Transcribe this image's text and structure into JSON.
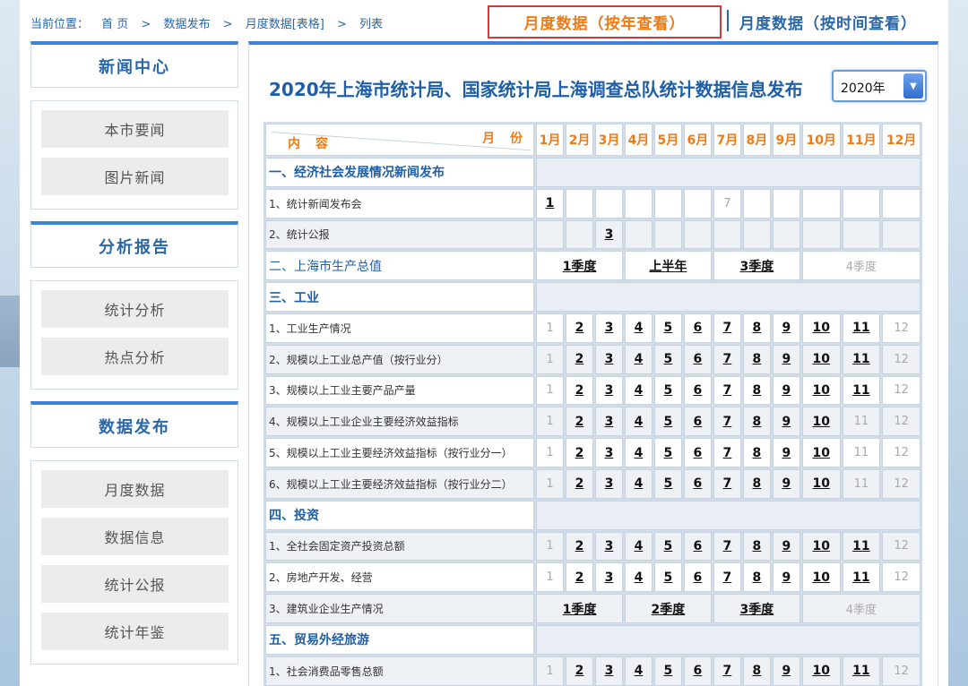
{
  "breadcrumb": {
    "prefix": "当前位置：",
    "items": [
      "首 页",
      "数据发布",
      "月度数据[表格]",
      "列表"
    ],
    "sep": ">"
  },
  "view_tabs": {
    "by_year": "月度数据（按年查看）",
    "by_time": "月度数据（按时间查看）"
  },
  "sidebar": {
    "sections": [
      {
        "title": "新闻中心",
        "items": [
          "本市要闻",
          "图片新闻"
        ]
      },
      {
        "title": "分析报告",
        "items": [
          "统计分析",
          "热点分析"
        ]
      },
      {
        "title": "数据发布",
        "items": [
          "月度数据",
          "数据信息",
          "统计公报",
          "统计年鉴"
        ]
      }
    ]
  },
  "main": {
    "title": "2020年上海市统计局、国家统计局上海调查总队统计数据信息发布",
    "year_select": "2020年",
    "header": {
      "content_label": "内 容",
      "month_label": "月 份",
      "months": [
        "1月",
        "2月",
        "3月",
        "4月",
        "5月",
        "6月",
        "7月",
        "8月",
        "9月",
        "10月",
        "11月",
        "12月"
      ]
    },
    "rows": [
      {
        "type": "section",
        "label": "一、经济社会发展情况新闻发布"
      },
      {
        "type": "monthly",
        "label": "1、统计新闻发布会",
        "cells": [
          {
            "t": "1",
            "on": true
          },
          {
            "t": ""
          },
          {
            "t": ""
          },
          {
            "t": ""
          },
          {
            "t": ""
          },
          {
            "t": ""
          },
          {
            "t": "7",
            "on": false
          },
          {
            "t": ""
          },
          {
            "t": ""
          },
          {
            "t": ""
          },
          {
            "t": ""
          },
          {
            "t": ""
          }
        ]
      },
      {
        "type": "monthly",
        "label": "2、统计公报",
        "alt": true,
        "cells": [
          {
            "t": ""
          },
          {
            "t": ""
          },
          {
            "t": "3",
            "on": true
          },
          {
            "t": ""
          },
          {
            "t": ""
          },
          {
            "t": ""
          },
          {
            "t": ""
          },
          {
            "t": ""
          },
          {
            "t": ""
          },
          {
            "t": ""
          },
          {
            "t": ""
          },
          {
            "t": ""
          }
        ]
      },
      {
        "type": "quarter",
        "label": "二、上海市生产总值",
        "blue": true,
        "q": [
          {
            "t": "1季度",
            "on": true
          },
          {
            "t": "上半年",
            "on": true
          },
          {
            "t": "3季度",
            "on": true
          },
          {
            "t": "4季度",
            "on": false
          }
        ]
      },
      {
        "type": "section",
        "label": "三、工业"
      },
      {
        "type": "monthly",
        "label": "1、工业生产情况",
        "cells": "std11"
      },
      {
        "type": "monthly",
        "label": "2、规模以上工业总产值（按行业分）",
        "alt": true,
        "cells": "std11"
      },
      {
        "type": "monthly",
        "label": "3、规模以上工业主要产品产量",
        "cells": "std11"
      },
      {
        "type": "monthly",
        "label": "4、规模以上工业企业主要经济效益指标",
        "alt": true,
        "cells": "std10"
      },
      {
        "type": "monthly",
        "label": "5、规模以上工业主要经济效益指标（按行业分一）",
        "cells": "std10"
      },
      {
        "type": "monthly",
        "label": "6、规模以上工业主要经济效益指标（按行业分二）",
        "alt": true,
        "cells": "std10"
      },
      {
        "type": "section",
        "label": "四、投资"
      },
      {
        "type": "monthly",
        "label": "1、全社会固定资产投资总额",
        "alt": true,
        "cells": "std11"
      },
      {
        "type": "monthly",
        "label": "2、房地产开发、经营",
        "cells": "std11"
      },
      {
        "type": "quarter",
        "label": "3、建筑业企业生产情况",
        "alt": true,
        "q": [
          {
            "t": "1季度",
            "on": true
          },
          {
            "t": "2季度",
            "on": true
          },
          {
            "t": "3季度",
            "on": true
          },
          {
            "t": "4季度",
            "on": false
          }
        ]
      },
      {
        "type": "section",
        "label": "五、贸易外经旅游"
      },
      {
        "type": "monthly",
        "label": "1、社会消费品零售总额",
        "alt": true,
        "cells": "std11"
      }
    ]
  }
}
